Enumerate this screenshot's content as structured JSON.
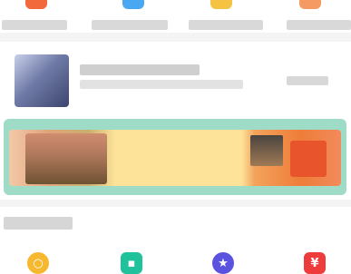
{
  "top_icons": [
    {
      "name": "category-icon-1",
      "color": "#f26a3c"
    },
    {
      "name": "category-icon-2",
      "color": "#4aa8f2"
    },
    {
      "name": "category-icon-3",
      "color": "#f5c242"
    },
    {
      "name": "category-icon-4",
      "color": "#f59a62"
    }
  ],
  "card": {
    "title": "",
    "subtitle": "",
    "meta": ""
  },
  "banner": {
    "accent_color": "#9fdcc7"
  },
  "section": {
    "title": ""
  },
  "bottom_nav": [
    {
      "icon": "ring-icon",
      "glyph": "○",
      "color": "#f5b82e"
    },
    {
      "icon": "note-icon",
      "glyph": "▪",
      "color": "#1fc29a"
    },
    {
      "icon": "star-icon",
      "glyph": "★",
      "color": "#5b52e0"
    },
    {
      "icon": "yen-icon",
      "glyph": "¥",
      "color": "#ee3b3b"
    }
  ]
}
